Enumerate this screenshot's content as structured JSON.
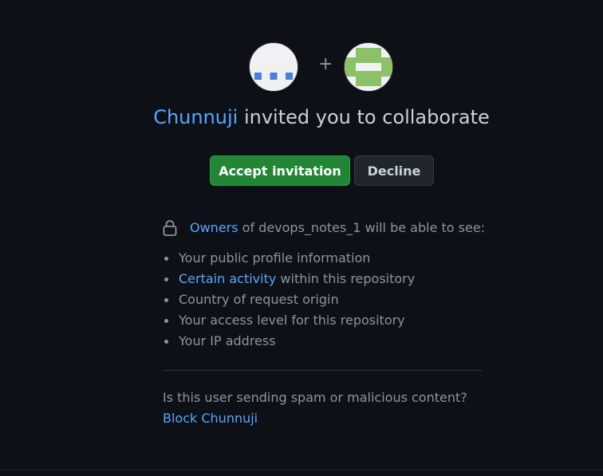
{
  "invitation": {
    "inviter": "Chunnuji",
    "title_suffix": " invited you to collaborate",
    "plus_sign": "+",
    "inviter_avatar_icon": "identicon-blue-dots",
    "invitee_avatar_icon": "identicon-green-pattern"
  },
  "actions": {
    "accept_label": "Accept invitation",
    "decline_label": "Decline"
  },
  "privacy": {
    "lock_icon": "lock-icon",
    "owners_link": "Owners",
    "owners_suffix": " of devops_notes_1 will be able to see:",
    "items": [
      {
        "text": "Your public profile information"
      },
      {
        "link": "Certain activity",
        "text": " within this repository"
      },
      {
        "text": "Country of request origin"
      },
      {
        "text": "Your access level for this repository"
      },
      {
        "text": "Your IP address"
      }
    ]
  },
  "report": {
    "question": "Is this user sending spam or malicious content?",
    "block_link": "Block Chunnuji"
  },
  "colors": {
    "background": "#0d1117",
    "accent_link": "#58a6ff",
    "accept_green": "#238636",
    "muted_text": "#8b949e"
  }
}
